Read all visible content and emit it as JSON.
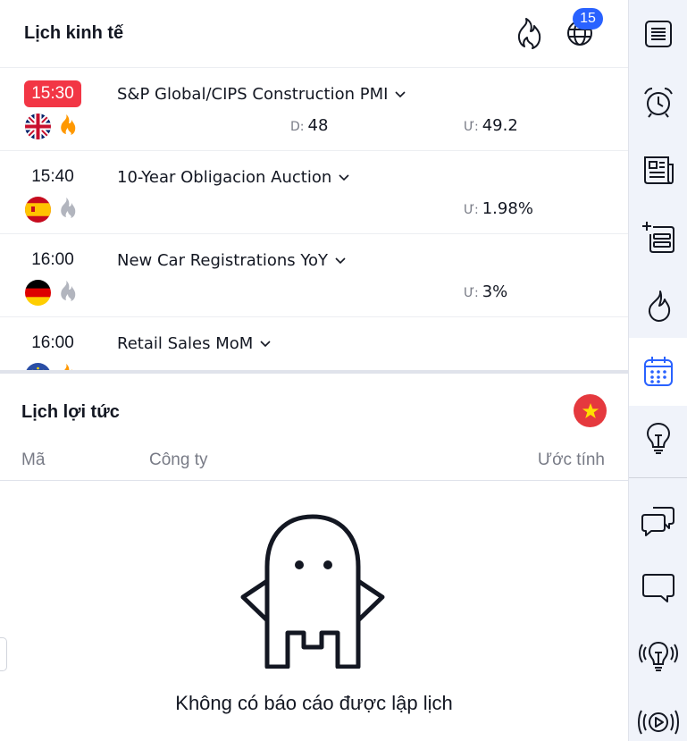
{
  "economic_calendar": {
    "title": "Lịch kinh tế",
    "notification_count": "15",
    "events": [
      {
        "time": "15:30",
        "active": true,
        "country": "uk",
        "importance": "high",
        "title": "S&P Global/CIPS Construction PMI",
        "d_label": "D:",
        "d_value": "48",
        "u_label": "Ư:",
        "u_value": "49.2"
      },
      {
        "time": "15:40",
        "active": false,
        "country": "spain",
        "importance": "low",
        "title": "10-Year Obligacion Auction",
        "d_label": "",
        "d_value": "",
        "u_label": "Ư:",
        "u_value": "1.98%"
      },
      {
        "time": "16:00",
        "active": false,
        "country": "germany",
        "importance": "low",
        "title": "New Car Registrations YoY",
        "d_label": "",
        "d_value": "",
        "u_label": "Ư:",
        "u_value": "3%"
      },
      {
        "time": "16:00",
        "active": false,
        "country": "eu",
        "importance": "high",
        "title": "Retail Sales MoM",
        "d_label": "",
        "d_value": "",
        "u_label": "",
        "u_value": ""
      }
    ]
  },
  "earnings_calendar": {
    "title": "Lịch lợi tức",
    "columns": {
      "symbol": "Mã",
      "company": "Công ty",
      "estimate": "Ước tính"
    },
    "empty_message": "Không có báo cáo được lập lịch"
  },
  "colors": {
    "accent": "#2962ff",
    "alert_red": "#f23645",
    "fire_orange": "#ff9800",
    "fire_gray": "#b2b5be"
  },
  "right_sidebar": {
    "items": [
      {
        "icon": "watchlist-icon"
      },
      {
        "icon": "alarm-clock-icon"
      },
      {
        "icon": "news-icon"
      },
      {
        "icon": "add-list-icon"
      },
      {
        "icon": "hotlist-fire-icon"
      },
      {
        "icon": "calendar-icon",
        "active": true
      },
      {
        "icon": "ideas-lightbulb-icon"
      },
      {
        "icon": "chats-icon"
      },
      {
        "icon": "chat-icon"
      },
      {
        "icon": "streams-lightbulb-icon"
      },
      {
        "icon": "broadcast-play-icon"
      }
    ]
  }
}
